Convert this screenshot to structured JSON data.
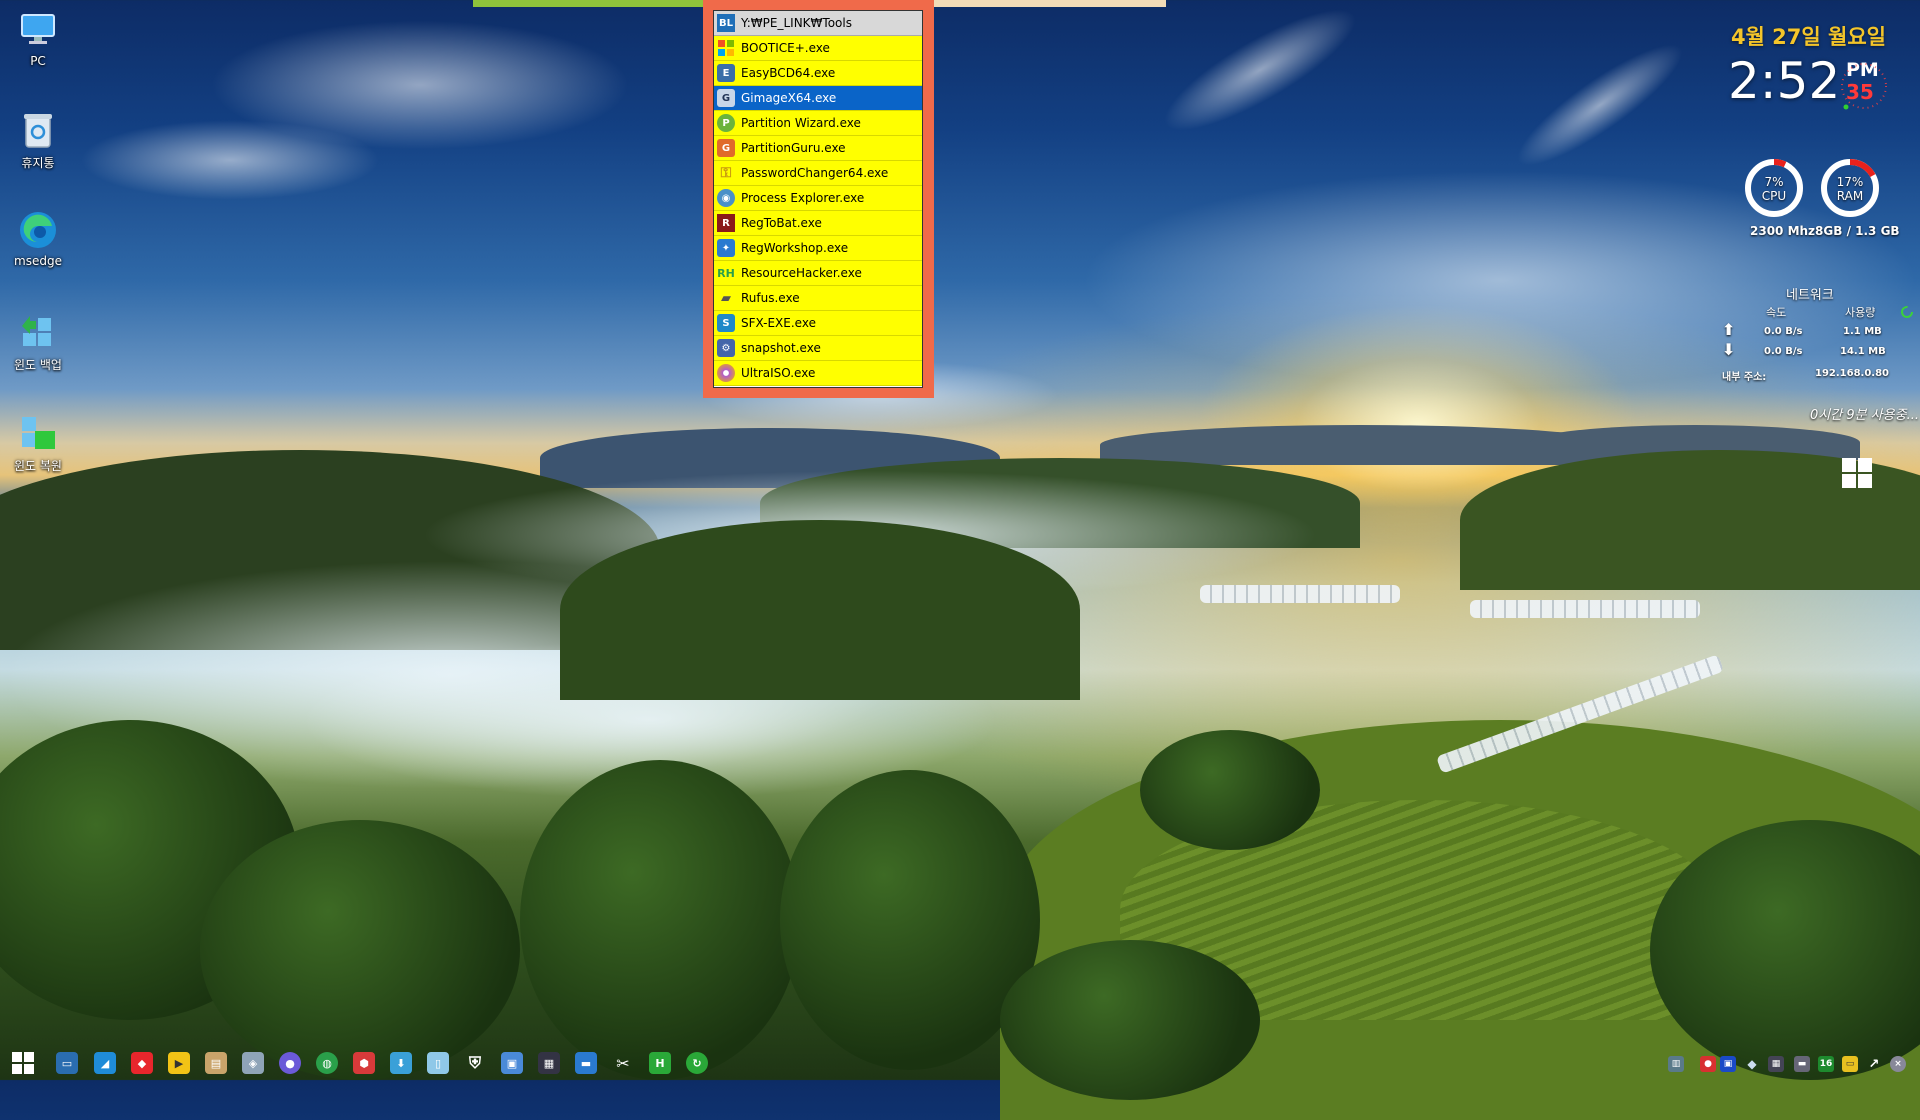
{
  "desktop_icons": [
    {
      "label": "PC",
      "icon": "computer-icon"
    },
    {
      "label": "휴지통",
      "icon": "recycle-bin-icon"
    },
    {
      "label": "msedge",
      "icon": "edge-icon"
    },
    {
      "label": "윈도 백업",
      "icon": "windows-backup-icon"
    },
    {
      "label": "윈도 복원",
      "icon": "windows-restore-icon"
    }
  ],
  "launcher_menu": {
    "path": "Y:₩PE_LINK₩Tools",
    "header_icon_text": "BL",
    "selected_item": "GimageX64.exe",
    "items": [
      {
        "label": "BOOTICE+.exe",
        "icon": "windows-flag-icon"
      },
      {
        "label": "EasyBCD64.exe",
        "icon": "easybcd-icon"
      },
      {
        "label": "GimageX64.exe",
        "icon": "gimagex-icon"
      },
      {
        "label": "Partition Wizard.exe",
        "icon": "partition-wizard-icon"
      },
      {
        "label": "PartitionGuru.exe",
        "icon": "partitionguru-icon"
      },
      {
        "label": "PasswordChanger64.exe",
        "icon": "key-icon"
      },
      {
        "label": "Process Explorer.exe",
        "icon": "process-explorer-icon"
      },
      {
        "label": "RegToBat.exe",
        "icon": "regtobat-icon"
      },
      {
        "label": "RegWorkshop.exe",
        "icon": "regworkshop-icon"
      },
      {
        "label": "ResourceHacker.exe",
        "icon": "resourcehacker-icon"
      },
      {
        "label": "Rufus.exe",
        "icon": "usb-drive-icon"
      },
      {
        "label": "SFX-EXE.exe",
        "icon": "sfx-icon"
      },
      {
        "label": "snapshot.exe",
        "icon": "snapshot-icon"
      },
      {
        "label": "UltraISO.exe",
        "icon": "disc-icon"
      }
    ]
  },
  "clock": {
    "date": "4월 27일 월요일",
    "time": "2:52",
    "ampm": "PM",
    "seconds": "35"
  },
  "system": {
    "cpu_percent": "7%",
    "cpu_label": "CPU",
    "cpu_fraction": 0.07,
    "ram_percent": "17%",
    "ram_label": "RAM",
    "ram_fraction": 0.17,
    "info": "2300 Mhz8GB /  1.3 GB"
  },
  "network": {
    "title": "네트워크",
    "col_speed": "속도",
    "col_usage": "사용량",
    "up_speed": "0.0 B/s",
    "up_usage": "1.1 MB",
    "down_speed": "0.0 B/s",
    "down_usage": "14.1 MB",
    "ip_label": "내부 주소:",
    "ip": "192.168.0.80",
    "uptime": "0시간 9분 사용중..."
  },
  "colors": {
    "menu_frame": "#f06a4a",
    "menu_item_bg": "#ffff00",
    "menu_selected": "#0a64c8",
    "date_color": "#f4c52a",
    "seconds_color": "#ff3a3a",
    "gauge_track": "#ffffff",
    "gauge_fill": "#e8211c"
  },
  "taskbar": {
    "start_icon": "windows-start-icon",
    "pinned": [
      "monitor-icon",
      "paint-icon",
      "anydesk-icon",
      "potplayer-icon",
      "archive-icon",
      "disk-tool-icon",
      "browser-icon",
      "globe-icon",
      "network-icon",
      "installer-icon",
      "file-icon",
      "shield-icon",
      "window-tool-icon",
      "display-icon",
      "pc-icon",
      "scissors-icon",
      "hex-editor-icon",
      "refresh-icon"
    ],
    "tray": [
      "network-tray-icon",
      "red-app-icon",
      "blue-app-icon",
      "drop-icon",
      "grid-icon",
      "hdd-icon",
      "badge-16-icon",
      "chat-icon",
      "arrow-icon",
      "close-circle-icon"
    ],
    "tray_badge": "16"
  }
}
